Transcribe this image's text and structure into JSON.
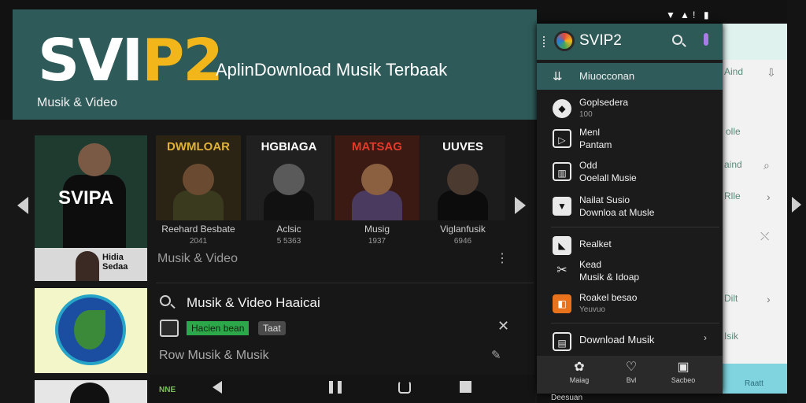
{
  "banner": {
    "logo_main": "SVI",
    "logo_accent": "P2",
    "tagline": "AplinDownload Musik Terbaak",
    "subtitle": "Musik & Video"
  },
  "featured": {
    "card1_text": "SVIPA",
    "card2_text": "Hidia Sedaa"
  },
  "albums": [
    {
      "cover_title": "DWMLOAR",
      "label": "Reehard Besbate",
      "sub": "2041"
    },
    {
      "cover_title": "HGBIAGA",
      "label": "Aclsic",
      "sub": "5 5363"
    },
    {
      "cover_title": "MATSAG",
      "label": "Musig",
      "sub": "1937"
    },
    {
      "cover_title": "UUVES",
      "label": "Viglanfusik",
      "sub": "6946"
    }
  ],
  "list": {
    "section_label": "Musik & Video",
    "search_title": "Musik & Video Haaicai",
    "badge_primary": "Hacien bean",
    "badge_secondary": "Taat",
    "row2": "Row Musik & Musik"
  },
  "navbar": {
    "tag": "NNE"
  },
  "status": {
    "wifi": "▼",
    "signal": "▲",
    "alert": "!",
    "battery": "▮"
  },
  "drawer": {
    "title": "SVIP2",
    "active_item": {
      "label": "Miuocconan",
      "icon": "downloads-icon"
    },
    "items": [
      {
        "line1": "Goplsedera",
        "line2": "100"
      },
      {
        "line1": "Menl",
        "line2": "Pantam"
      },
      {
        "line1": "Odd",
        "line2": "Ooelall Musie"
      },
      {
        "line1": "Nailat Susio",
        "line2": "Downloa at Musle"
      },
      {
        "line1": "Realket",
        "line2": ""
      },
      {
        "line1": "Kead",
        "line2": "Musik & Idoap"
      },
      {
        "line1": "Roakel besao",
        "line2": "Yeuvuo"
      },
      {
        "line1": "Download Musik",
        "line2": ""
      }
    ],
    "chevron": "›",
    "bottom_tabs": [
      {
        "icon": "✿",
        "label": "Maiag"
      },
      {
        "icon": "♡",
        "label": "Bvl"
      },
      {
        "icon": "▣",
        "label": "Sacbeo"
      }
    ],
    "peek_text": "Deesuan"
  },
  "back_panel": {
    "items": [
      "Aind",
      "olle",
      "aind",
      "Rlle",
      "Dilt",
      "Isik"
    ],
    "bottom_label": "Raatt"
  },
  "colors": {
    "teal": "#2e5b59",
    "accent_yellow": "#f2b61b",
    "active_green": "#2ca84a"
  }
}
